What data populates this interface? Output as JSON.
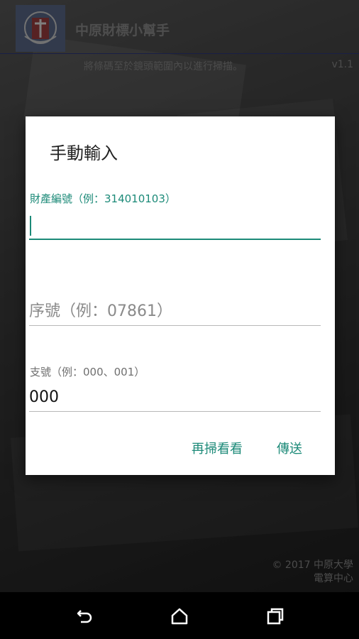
{
  "app": {
    "title": "中原財標小幫手",
    "scan_hint": "將條碼至於鏡頭範圍內以進行掃描。",
    "version": "v1.1",
    "copyright_line1": "© 2017 中原大學",
    "copyright_line2": "電算中心"
  },
  "dialog": {
    "title": "手動輸入",
    "property_number": {
      "label": "財產編號（例：314010103）",
      "value": ""
    },
    "serial_number": {
      "placeholder": "序號（例：07861）",
      "value": ""
    },
    "branch_number": {
      "label": "支號（例：000、001）",
      "value": "000"
    },
    "buttons": {
      "rescan": "再掃看看",
      "send": "傳送"
    }
  },
  "colors": {
    "accent": "#1c8a78",
    "scrim": "rgba(0,0,0,0.45)",
    "dialog_bg": "#ffffff"
  },
  "navbar": {
    "icons": [
      "back-icon",
      "home-icon",
      "recent-apps-icon"
    ]
  }
}
